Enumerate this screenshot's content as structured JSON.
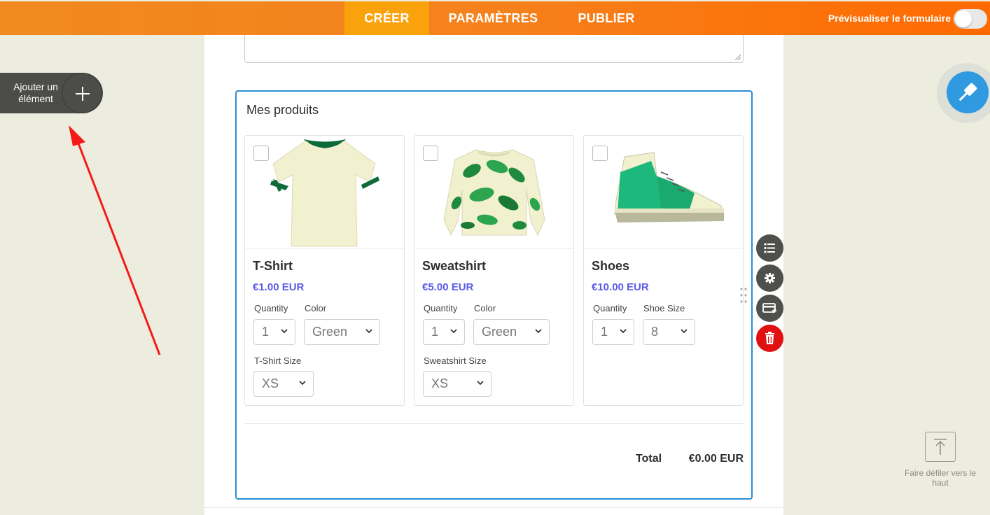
{
  "topbar": {
    "tabs": [
      {
        "label": "CRÉER",
        "active": true
      },
      {
        "label": "PARAMÈTRES",
        "active": false
      },
      {
        "label": "PUBLIER",
        "active": false
      }
    ],
    "preview_label": "Prévisualiser le formulaire",
    "preview_enabled": false
  },
  "add_element": {
    "label": "Ajouter un élément",
    "icon": "plus-icon"
  },
  "products": {
    "title": "Mes produits",
    "items": [
      {
        "name": "T-Shirt",
        "price": "€1.00 EUR",
        "icon": "tshirt-image",
        "options": [
          {
            "label": "Quantity",
            "value": "1"
          },
          {
            "label": "Color",
            "value": "Green"
          },
          {
            "label": "T-Shirt Size",
            "value": "XS"
          }
        ]
      },
      {
        "name": "Sweatshirt",
        "price": "€5.00 EUR",
        "icon": "sweatshirt-image",
        "options": [
          {
            "label": "Quantity",
            "value": "1"
          },
          {
            "label": "Color",
            "value": "Green"
          },
          {
            "label": "Sweatshirt Size",
            "value": "XS"
          }
        ]
      },
      {
        "name": "Shoes",
        "price": "€10.00 EUR",
        "icon": "shoe-image",
        "options": [
          {
            "label": "Quantity",
            "value": "1"
          },
          {
            "label": "Shoe Size",
            "value": "8"
          }
        ]
      }
    ],
    "total_label": "Total",
    "total_value": "€0.00 EUR"
  },
  "tools": [
    "list-icon",
    "gear-icon",
    "payment-card-icon",
    "trash-icon"
  ],
  "scroll_top": {
    "label": "Faire défiler vers le haut",
    "icon": "arrow-up-icon"
  },
  "colors": {
    "accent_orange": "#f6811c",
    "active_tab": "#f9a20c",
    "price": "#5b5bea",
    "selection_border": "#2a8dd4",
    "delete": "#e01010",
    "design_button": "#2f9ae0"
  }
}
